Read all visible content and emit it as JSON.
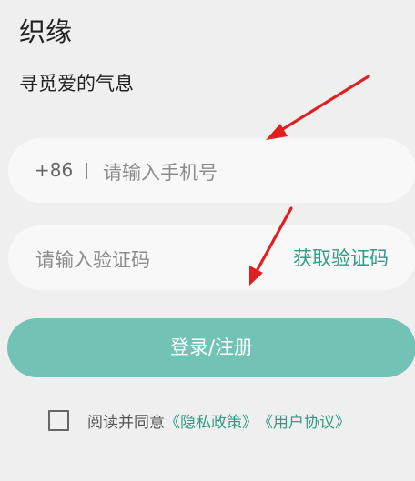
{
  "header": {
    "app_name": "织缘",
    "slogan": "寻觅爱的气息"
  },
  "phone_field": {
    "country_code": "+86",
    "placeholder": "请输入手机号",
    "value": ""
  },
  "code_field": {
    "placeholder": "请输入验证码",
    "value": "",
    "get_code_label": "获取验证码"
  },
  "login_button": {
    "label": "登录/注册"
  },
  "agreement": {
    "checked": false,
    "prefix": "阅读并同意",
    "privacy_link": "《隐私政策》",
    "user_link": "《用户协议》"
  },
  "colors": {
    "background": "#efefef",
    "field_background": "#f8f8f8",
    "accent": "#2e9c86",
    "button": "#72c3b6",
    "annotation_arrow": "#e02020"
  }
}
